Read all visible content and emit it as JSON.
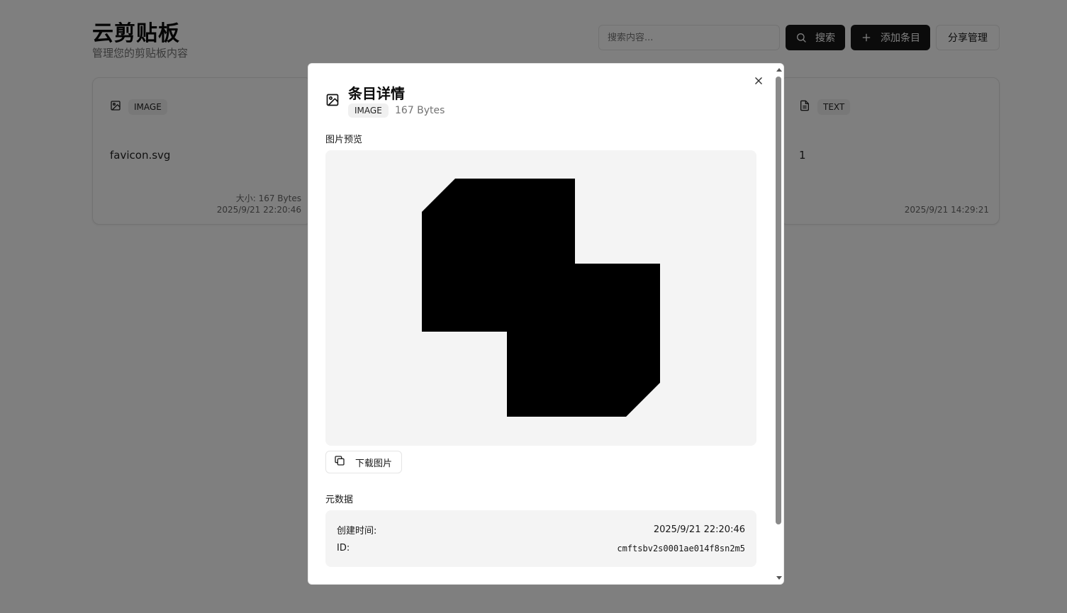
{
  "app": {
    "title": "云剪贴板",
    "subtitle": "管理您的剪贴板内容"
  },
  "header": {
    "search_placeholder": "搜索内容...",
    "search_button": "搜索",
    "add_button": "添加条目",
    "share_button": "分享管理"
  },
  "cards": [
    {
      "type_badge": "IMAGE",
      "icon": "image-icon",
      "content": "favicon.svg",
      "size": "大小: 167 Bytes",
      "date": "2025/9/21 22:20:46"
    },
    {
      "type_badge": "TEXT",
      "icon": "file-text-icon",
      "content": "1",
      "date": "2025/9/21 14:29:21"
    }
  ],
  "modal": {
    "title": "条目详情",
    "type_badge": "IMAGE",
    "size": "167 Bytes",
    "preview_label": "图片预览",
    "download_button": "下载图片",
    "metadata_label": "元数据",
    "metadata": {
      "created_label": "创建时间:",
      "created_value": "2025/9/21 22:20:46",
      "id_label": "ID:",
      "id_value": "cmftsbv2s0001ae014f8sn2m5"
    }
  },
  "colors": {
    "primary_button": "#171717",
    "overlay": "rgba(0,0,0,0.5)",
    "panel_gray": "#f4f4f4"
  }
}
